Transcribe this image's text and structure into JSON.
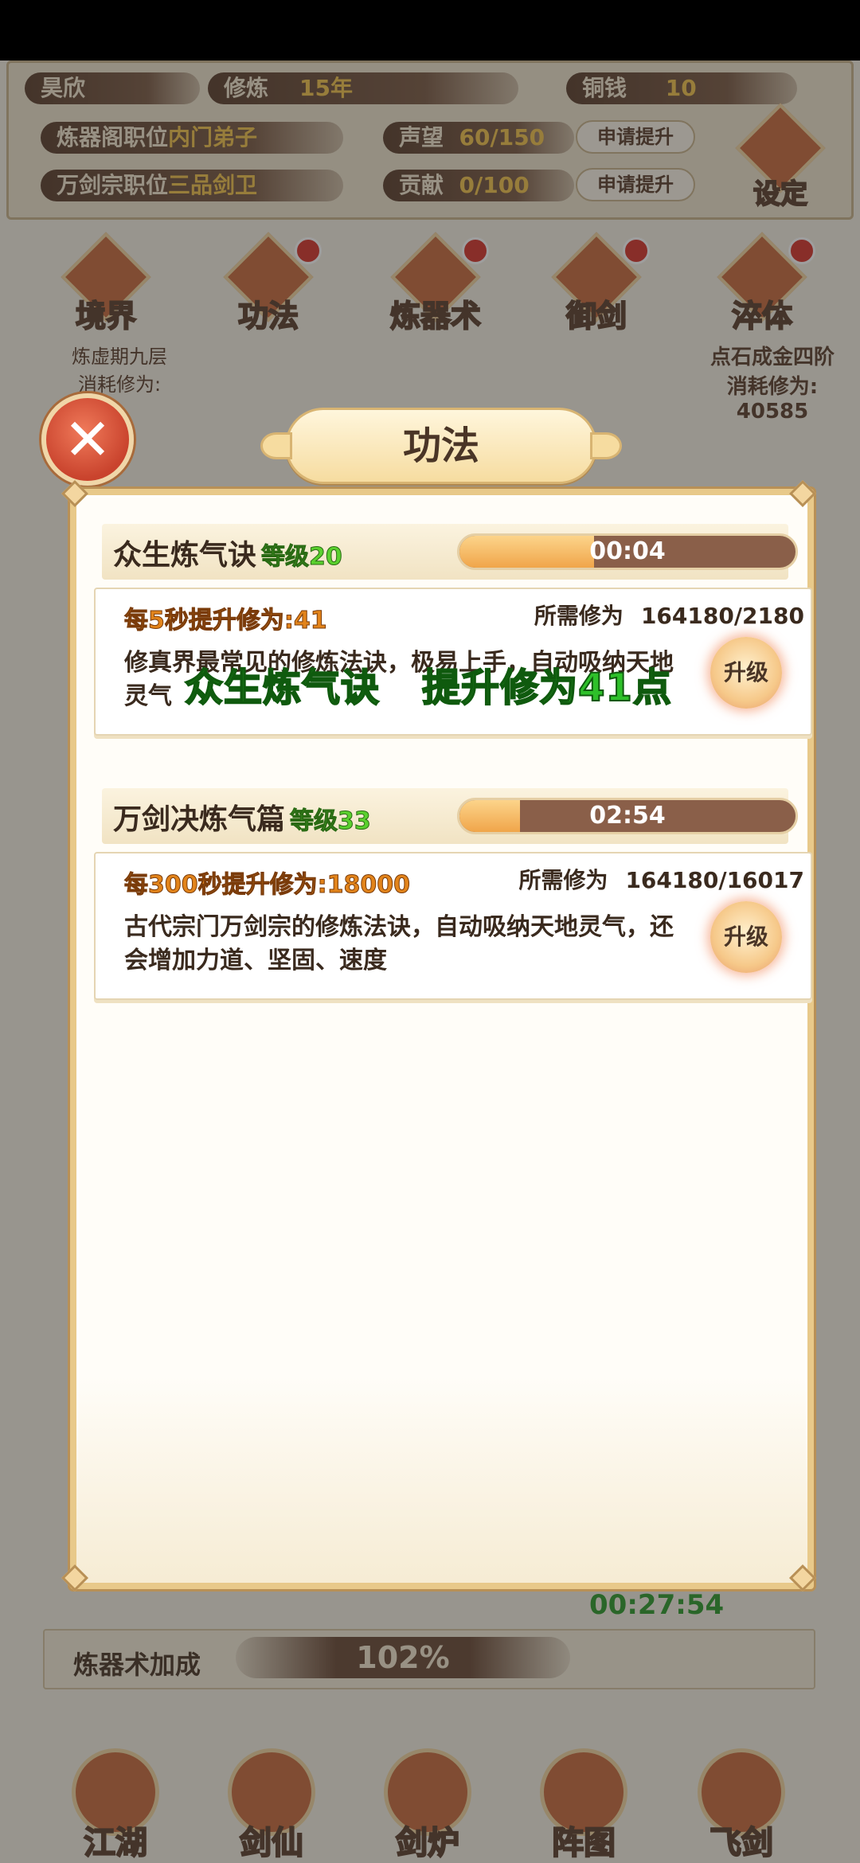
{
  "background": {
    "player_name": "昊欣",
    "cultivation_label": "修炼",
    "cultivation_value": "15年",
    "coins_label": "铜钱",
    "coins_value": "10",
    "forge_position_label": "炼器阁职位",
    "forge_position_value": "内门弟子",
    "sect_position_label": "万剑宗职位",
    "sect_position_value": "三品剑卫",
    "prestige_label": "声望",
    "prestige_value": "60/150",
    "contribution_label": "贡献",
    "contribution_value": "0/100",
    "apply_promotion_label": "申请提升",
    "settings_label": "设定",
    "menu": [
      {
        "label": "境界"
      },
      {
        "label": "功法"
      },
      {
        "label": "炼器术"
      },
      {
        "label": "御剑"
      },
      {
        "label": "淬体"
      }
    ],
    "realm_sub1": "炼虚期九层",
    "realm_sub2": "消耗修为:",
    "body_sub1": "点石成金四阶",
    "body_sub2": "消耗修为:",
    "body_sub3": "40585",
    "timer": "00:27:54",
    "bonus_label": "炼器术加成",
    "bonus_value": "102%",
    "bottom_nav": [
      {
        "label": "江湖"
      },
      {
        "label": "剑仙"
      },
      {
        "label": "剑炉"
      },
      {
        "label": "阵图"
      },
      {
        "label": "飞剑"
      }
    ]
  },
  "modal": {
    "title": "功法",
    "close_icon": "close-x",
    "cards": [
      {
        "name": "众生炼气诀",
        "level": "等级20",
        "timer": "00:04",
        "progress": 0.4,
        "rate": "每5秒提升修为:41",
        "required_label": "所需修为",
        "required_value": "164180/2180",
        "description": "修真界最常见的修炼法诀，极易上手，自动吸纳天地灵气",
        "upgrade_label": "升级"
      },
      {
        "name": "万剑决炼气篇",
        "level": "等级33",
        "timer": "02:54",
        "progress": 0.18,
        "rate": "每300秒提升修为:18000",
        "required_label": "所需修为",
        "required_value": "164180/16017",
        "description": "古代宗门万剑宗的修炼法诀，自动吸纳天地灵气，还会增加力道、坚固、速度",
        "upgrade_label": "升级"
      }
    ]
  },
  "toast": "众生炼气诀   提升修为41点"
}
